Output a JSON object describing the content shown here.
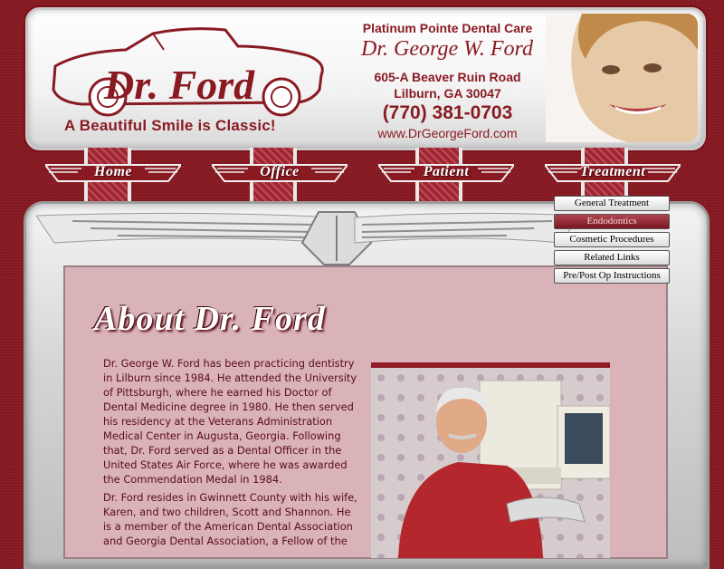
{
  "header": {
    "logo_text": "Dr. Ford",
    "tagline": "A Beautiful Smile is Classic!",
    "practice_name": "Platinum Pointe Dental Care",
    "doctor_name": "Dr. George W. Ford",
    "address_line1": "605-A Beaver Ruin Road",
    "address_line2": "Lilburn, GA 30047",
    "phone": "(770) 381-0703",
    "website": "www.DrGeorgeFord.com"
  },
  "nav": {
    "items": [
      {
        "label": "Home"
      },
      {
        "label": "Office"
      },
      {
        "label": "Patient"
      },
      {
        "label": "Treatment"
      }
    ]
  },
  "submenu": {
    "items": [
      {
        "label": "General Treatment",
        "active": false
      },
      {
        "label": "Endodontics",
        "active": true
      },
      {
        "label": "Cosmetic Procedures",
        "active": false
      },
      {
        "label": "Related Links",
        "active": false
      },
      {
        "label": "Pre/Post Op Instructions",
        "active": false
      }
    ]
  },
  "main": {
    "heading": "About Dr. Ford",
    "paragraphs": [
      "Dr. George W. Ford has been practicing dentistry in Lilburn since 1984. He attended the University of Pittsburgh, where he earned his Doctor of Dental Medicine degree in 1980. He then served his residency at the Veterans Administration Medical Center in Augusta, Georgia. Following that, Dr. Ford served as a Dental Officer in the United States Air Force, where he was awarded the Commendation Medal in 1984.",
      "Dr. Ford resides in Gwinnett County with his wife, Karen, and two children, Scott and Shannon. He is a member of the American Dental Association and Georgia Dental Association, a Fellow of the"
    ]
  },
  "colors": {
    "brand_red": "#8a1a22",
    "background": "#8e1d26",
    "content_bg": "#d9b3b8"
  }
}
